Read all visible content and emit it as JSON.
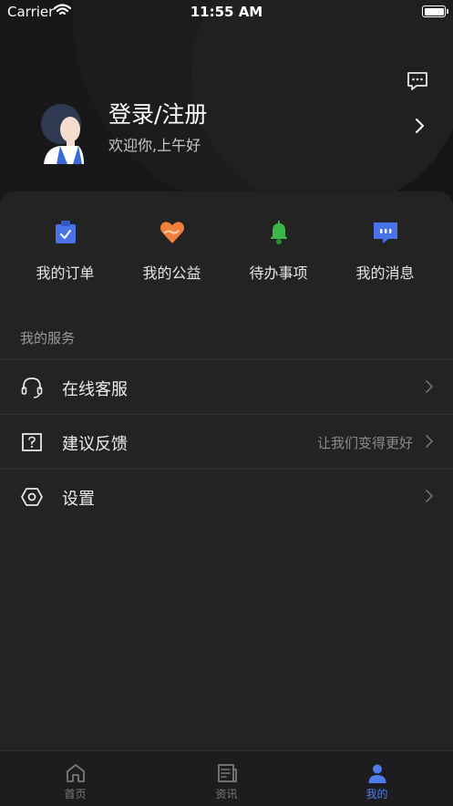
{
  "status_bar": {
    "carrier": "Carrier",
    "time": "11:55 AM"
  },
  "profile": {
    "title": "登录/注册",
    "greeting": "欢迎你,上午好"
  },
  "quick_actions": [
    {
      "label": "我的订单",
      "icon": "clipboard-check-icon",
      "color": "#4a72e8"
    },
    {
      "label": "我的公益",
      "icon": "heart-hand-icon",
      "color": "#f0803a"
    },
    {
      "label": "待办事项",
      "icon": "bell-icon",
      "color": "#3db54a"
    },
    {
      "label": "我的消息",
      "icon": "chat-bubble-icon",
      "color": "#4a72e8"
    }
  ],
  "services": {
    "title": "我的服务",
    "items": [
      {
        "label": "在线客服",
        "value": "",
        "icon": "headset-icon"
      },
      {
        "label": "建议反馈",
        "value": "让我们变得更好",
        "icon": "question-box-icon"
      },
      {
        "label": "设置",
        "value": "",
        "icon": "settings-hexagon-icon"
      }
    ]
  },
  "tabs": [
    {
      "label": "首页",
      "icon": "home-icon",
      "active": false
    },
    {
      "label": "资讯",
      "icon": "news-icon",
      "active": false
    },
    {
      "label": "我的",
      "icon": "person-icon",
      "active": true
    }
  ],
  "colors": {
    "accent": "#4f7bf0",
    "background": "#222224",
    "header": "#151515"
  }
}
